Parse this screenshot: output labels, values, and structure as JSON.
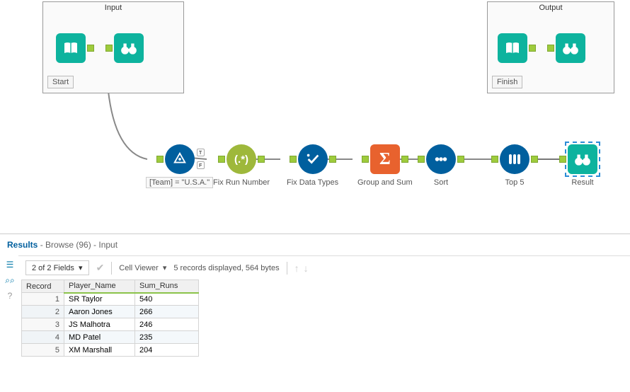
{
  "containers": {
    "input": {
      "title": "Input",
      "label": "Start"
    },
    "output": {
      "title": "Output",
      "label": "Finish"
    }
  },
  "tools": {
    "filter": {
      "label": "[Team] = \"U.S.A.\""
    },
    "fixrun": {
      "label": "Fix Run Number"
    },
    "fixtypes": {
      "label": "Fix Data Types"
    },
    "groupsum": {
      "label": "Group and Sum"
    },
    "sort": {
      "label": "Sort"
    },
    "top5": {
      "label": "Top 5"
    },
    "result": {
      "label": "Result"
    }
  },
  "results_header": {
    "title": "Results",
    "suffix": " - Browse (96) - Input"
  },
  "toolbar": {
    "fields": "2 of 2 Fields",
    "cellviewer": "Cell Viewer",
    "status": "5 records displayed, 564 bytes"
  },
  "table": {
    "headers": {
      "record": "Record",
      "player": "Player_Name",
      "runs": "Sum_Runs"
    },
    "rows": [
      {
        "n": "1",
        "player": "SR Taylor",
        "runs": "540"
      },
      {
        "n": "2",
        "player": "Aaron Jones",
        "runs": "266"
      },
      {
        "n": "3",
        "player": "JS Malhotra",
        "runs": "246"
      },
      {
        "n": "4",
        "player": "MD Patel",
        "runs": "235"
      },
      {
        "n": "5",
        "player": "XM Marshall",
        "runs": "204"
      }
    ]
  }
}
